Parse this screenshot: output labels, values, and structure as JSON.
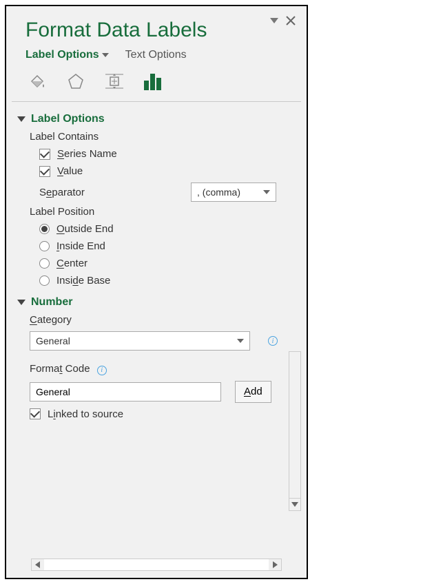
{
  "title": "Format Data Labels",
  "tabs": {
    "active": "Label Options",
    "other": "Text Options"
  },
  "sections": {
    "labelOptions": {
      "title": "Label Options",
      "contains": {
        "heading": "Label Contains",
        "series": "Series Name",
        "value": "Value"
      },
      "separator": {
        "label": "Separator",
        "value": ", (comma)"
      },
      "position": {
        "heading": "Label Position",
        "outsideEnd": "Outside End",
        "insideEnd": "Inside End",
        "center": "Center",
        "insideBase": "Inside Base"
      }
    },
    "number": {
      "title": "Number",
      "categoryLabel": "Category",
      "categoryValue": "General",
      "formatCodeLabel": "Format Code",
      "formatCodeValue": "General",
      "addLabel": "Add",
      "linked": "Linked to source"
    }
  }
}
